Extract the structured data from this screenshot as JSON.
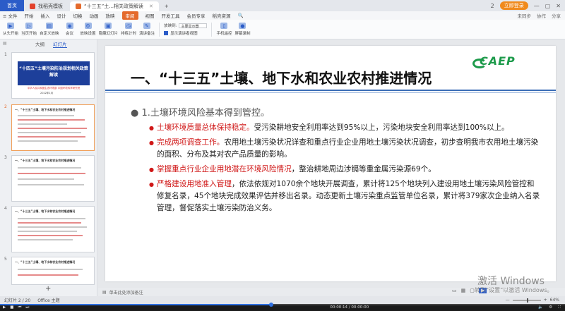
{
  "tabs": [
    {
      "label": "首页"
    },
    {
      "label": "找稻壳模板"
    },
    {
      "label": "“十三五”土...相关政策解读"
    }
  ],
  "tabbar_right": {
    "icon": "2",
    "login": "立即登录"
  },
  "menu": {
    "file": "≡ 文件",
    "items": [
      "开始",
      "插入",
      "设计",
      "切换",
      "动画",
      "放映",
      "审阅",
      "视图",
      "开发工具",
      "会员专享",
      "稻壳资源"
    ],
    "active_index": 6,
    "search": "🔍",
    "right": [
      "未同步",
      "协作",
      "分享"
    ]
  },
  "ribbon": {
    "buttons": [
      "从头开始",
      "当页开始",
      "自定义放映",
      "会议",
      "放映设置",
      "隐藏幻灯片",
      "排练计时",
      "演讲备注"
    ],
    "display_label": "放映到:",
    "display_value": "主要显示器",
    "presenter_view": "显示演讲者视图",
    "right_buttons": [
      "手机遥控",
      "屏幕录制"
    ]
  },
  "left_panel": {
    "tabs": [
      "大纲",
      "幻灯片"
    ],
    "active_tab": 1,
    "thumbs": [
      {
        "num": "1",
        "title": "“十四五”土壤污染防治规划相关政策解读",
        "sub": "中华人民共和国生态环境部 中国环境科学研究院",
        "date": "2022年1月"
      },
      {
        "num": "2",
        "title": "一、“十三五”土壤、地下水和农业农村推进情况"
      },
      {
        "num": "3",
        "title": "一、“十三五”土壤、地下水和农业农村推进情况"
      },
      {
        "num": "4",
        "title": "一、“十三五”土壤、地下水和农业农村推进情况"
      },
      {
        "num": "5",
        "title": "一、“十三五”土壤、地下水和农业农村推进情况"
      }
    ],
    "selected": 1
  },
  "slide": {
    "title": "一、“十三五”土壤、地下水和农业农村推进情况",
    "logo": "CAEP",
    "level1": "1.土壤环境风险基本得到管控。",
    "bullets": [
      {
        "highlight": "土壤环境质量总体保持稳定。",
        "text": "受污染耕地安全利用率达到95%以上，污染地块安全利用率达到100%以上。"
      },
      {
        "highlight": "完成两项调查工作。",
        "text": "农用地土壤污染状况详查和重点行业企业用地土壤污染状况调查，初步查明我市农用地土壤污染的面积、分布及其对农产品质量的影响。"
      },
      {
        "highlight": "掌握重点行业企业用地潜在环境风险情况",
        "text": "，整治耕地周边涉镉等重金属污染源69个。"
      },
      {
        "highlight": "严格建设用地准入管理",
        "text": "，依法依规对1070余个地块开展调查，累计将125个地块列入建设用地土壤污染风险管控和修复名录，45个地块完成效果评估并移出名录。动态更新土壤污染重点监管单位名录，累计将379家次企业纳入名录管理，督促落实土壤污染防治义务。"
      }
    ]
  },
  "notes": "单击此处添加备注",
  "watermark": {
    "line1": "激活 Windows",
    "line2": "转到“设置”以激活 Windows。"
  },
  "status": {
    "slide": "幻灯片 2 / 20",
    "theme": "Office 主题",
    "zoom": "64%"
  },
  "player": {
    "time": "00:00:14 / 00:00:00",
    "progress": 0.48
  }
}
